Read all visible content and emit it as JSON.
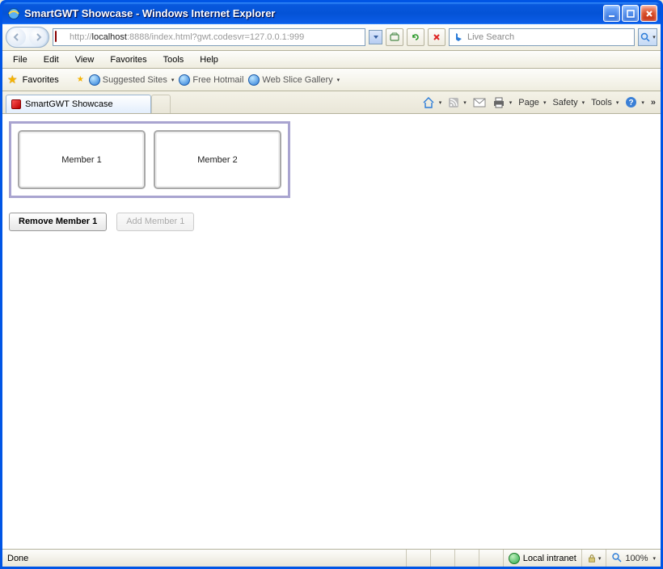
{
  "window": {
    "title": "SmartGWT Showcase - Windows Internet Explorer"
  },
  "address": {
    "prefix": "http://",
    "host": "localhost",
    "rest": ":8888/index.html?gwt.codesvr=127.0.0.1:999"
  },
  "search": {
    "placeholder": "Live Search"
  },
  "menu": {
    "file": "File",
    "edit": "Edit",
    "view": "View",
    "favorites": "Favorites",
    "tools": "Tools",
    "help": "Help"
  },
  "favbar": {
    "label": "Favorites",
    "suggested": "Suggested Sites",
    "hotmail": "Free Hotmail",
    "webslice": "Web Slice Gallery"
  },
  "tab": {
    "title": "SmartGWT Showcase"
  },
  "commands": {
    "page": "Page",
    "safety": "Safety",
    "tools": "Tools"
  },
  "content": {
    "member1": "Member 1",
    "member2": "Member 2",
    "removeBtn": "Remove Member 1",
    "addBtn": "Add Member 1"
  },
  "status": {
    "done": "Done",
    "zone": "Local intranet",
    "zoom": "100%"
  }
}
